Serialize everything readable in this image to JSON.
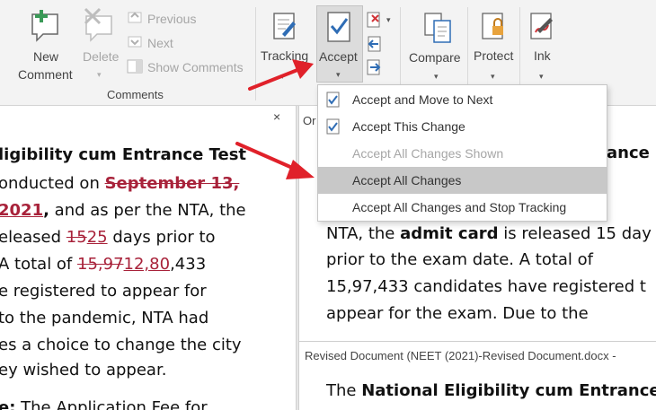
{
  "ribbon": {
    "new_comment": [
      "New",
      "Comment"
    ],
    "delete_label": "Delete",
    "previous_label": "Previous",
    "next_label": "Next",
    "show_comments_label": "Show Comments",
    "comments_group_label": "Comments",
    "tracking_label": "Tracking",
    "accept_label": "Accept",
    "compare_label": "Compare",
    "protect_label": "Protect",
    "ink_label": "Ink"
  },
  "accept_menu": {
    "items": [
      {
        "label": "Accept and Move to Next",
        "enabled": true,
        "highlighted": false
      },
      {
        "label": "Accept This Change",
        "enabled": true,
        "highlighted": false
      },
      {
        "label": "Accept All Changes Shown",
        "enabled": false,
        "highlighted": false
      },
      {
        "label": "Accept All Changes",
        "enabled": true,
        "highlighted": true
      },
      {
        "label": "Accept All Changes and Stop Tracking",
        "enabled": true,
        "highlighted": false
      }
    ]
  },
  "left_document": {
    "close_glyph": "×",
    "line1": "ligibility cum Entrance Test",
    "line2_a": "onducted on ",
    "line2_del": "September 13,",
    "line3_ins": "2021",
    "line3_b": ",",
    "line3_rest": " and as per the NTA, the",
    "line4_a": "eleased ",
    "line4_del": "15",
    "line4_ins": "25",
    "line4_rest": " days prior to",
    "line5_a": " A total of ",
    "line5_del": "15,97",
    "line5_ins": "12,80",
    "line5_rest": ",433",
    "line6": "e registered to appear for",
    "line7": "to the pandemic, NTA had",
    "line8": "es a choice to change the city",
    "line9": "ey wished to appear.",
    "line10_b": "e:",
    "line10_rest": " The Application Fee for"
  },
  "right_document": {
    "header_partial": "Or",
    "line1_b": "ance",
    "line2_a": "NTA, the ",
    "line2_b": "admit card",
    "line2_rest": " is released 15 day",
    "line3": "prior to the exam date. A total of",
    "line4": "15,97,433 candidates have registered t",
    "line5": "appear for the exam. Due to the"
  },
  "revised_document": {
    "header": "Revised Document (NEET (2021)-Revised Document.docx -",
    "line1_a": "The ",
    "line1_b": "National Eligibility cum Entrance"
  },
  "colors": {
    "revision": "#a8223a",
    "arrow": "#e0212a",
    "highlight": "#c8c8c8",
    "ribbon_bg": "#f3f3f3"
  }
}
